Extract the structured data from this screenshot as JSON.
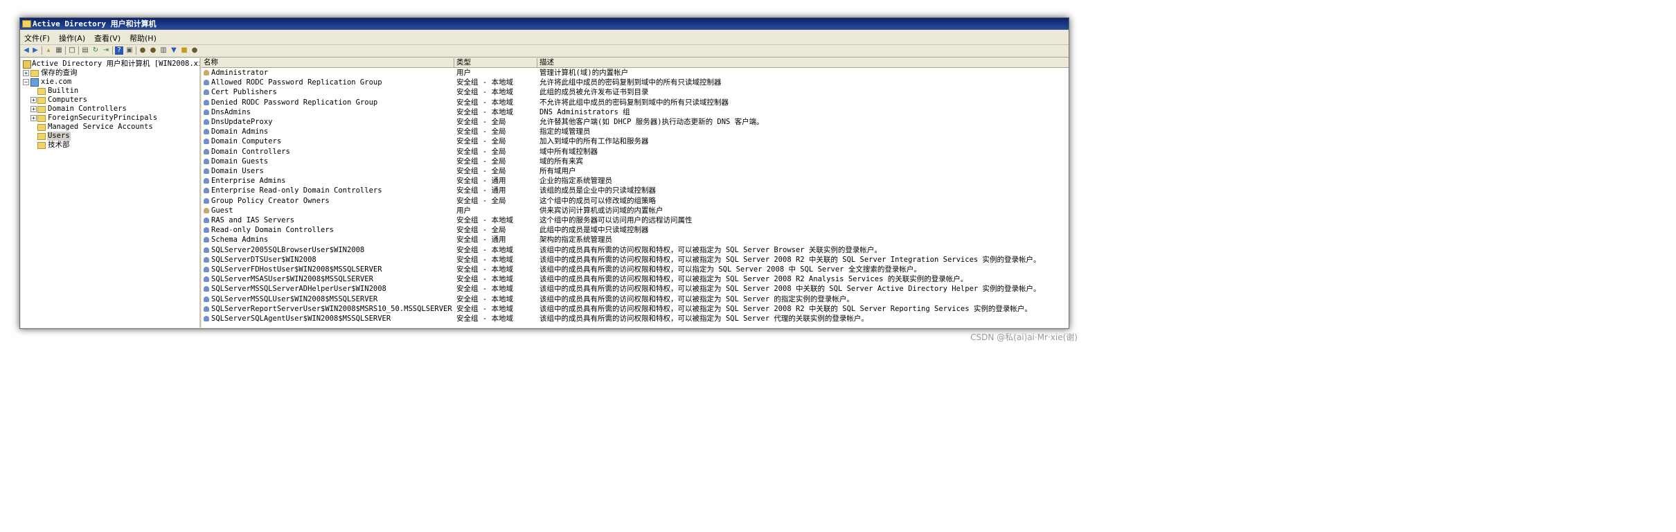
{
  "window": {
    "title": "Active Directory 用户和计算机"
  },
  "menu": [
    "文件(F)",
    "操作(A)",
    "查看(V)",
    "帮助(H)"
  ],
  "toolbar": {
    "icons": [
      "back-icon",
      "forward-icon",
      "up-icon",
      "show-tree-icon",
      "delete-icon",
      "properties-icon",
      "refresh-icon",
      "export-icon",
      "help-icon",
      "console-icon",
      "new-user-icon",
      "new-group-icon",
      "new-ou-icon",
      "filter-icon",
      "find-icon",
      "add-to-group-icon"
    ]
  },
  "tree": {
    "root": "Active Directory 用户和计算机 [WIN2008.xie",
    "saved_queries": "保存的查询",
    "domain": "xie.com",
    "children": [
      "Builtin",
      "Computers",
      "Domain Controllers",
      "ForeignSecurityPrincipals",
      "Managed Service Accounts",
      "Users",
      "技术部"
    ],
    "selected": "Users"
  },
  "columns": [
    "名称",
    "类型",
    "描述"
  ],
  "rows": [
    {
      "name": "Administrator",
      "type": "用户",
      "desc": "管理计算机(域)的内置帐户"
    },
    {
      "name": "Allowed RODC Password Replication Group",
      "type": "安全组 - 本地域",
      "desc": "允许将此组中成员的密码复制到域中的所有只读域控制器"
    },
    {
      "name": "Cert Publishers",
      "type": "安全组 - 本地域",
      "desc": "此组的成员被允许发布证书到目录"
    },
    {
      "name": "Denied RODC Password Replication Group",
      "type": "安全组 - 本地域",
      "desc": "不允许将此组中成员的密码复制到域中的所有只读域控制器"
    },
    {
      "name": "DnsAdmins",
      "type": "安全组 - 本地域",
      "desc": "DNS Administrators 组"
    },
    {
      "name": "DnsUpdateProxy",
      "type": "安全组 - 全局",
      "desc": "允许替其他客户端(如 DHCP 服务器)执行动态更新的 DNS 客户端。"
    },
    {
      "name": "Domain Admins",
      "type": "安全组 - 全局",
      "desc": "指定的域管理员"
    },
    {
      "name": "Domain Computers",
      "type": "安全组 - 全局",
      "desc": "加入到域中的所有工作站和服务器"
    },
    {
      "name": "Domain Controllers",
      "type": "安全组 - 全局",
      "desc": "域中所有域控制器"
    },
    {
      "name": "Domain Guests",
      "type": "安全组 - 全局",
      "desc": "域的所有来宾"
    },
    {
      "name": "Domain Users",
      "type": "安全组 - 全局",
      "desc": "所有域用户"
    },
    {
      "name": "Enterprise Admins",
      "type": "安全组 - 通用",
      "desc": "企业的指定系统管理员"
    },
    {
      "name": "Enterprise Read-only Domain Controllers",
      "type": "安全组 - 通用",
      "desc": "该组的成员是企业中的只读域控制器"
    },
    {
      "name": "Group Policy Creator Owners",
      "type": "安全组 - 全局",
      "desc": "这个组中的成员可以修改域的组策略"
    },
    {
      "name": "Guest",
      "type": "用户",
      "desc": "供来宾访问计算机或访问域的内置帐户"
    },
    {
      "name": "RAS and IAS Servers",
      "type": "安全组 - 本地域",
      "desc": "这个组中的服务器可以访问用户的远程访问属性"
    },
    {
      "name": "Read-only Domain Controllers",
      "type": "安全组 - 全局",
      "desc": "此组中的成员是域中只读域控制器"
    },
    {
      "name": "Schema Admins",
      "type": "安全组 - 通用",
      "desc": "架构的指定系统管理员"
    },
    {
      "name": "SQLServer2005SQLBrowserUser$WIN2008",
      "type": "安全组 - 本地域",
      "desc": "该组中的成员具有所需的访问权限和特权，可以被指定为 SQL Server Browser 关联实例的登录帐户。"
    },
    {
      "name": "SQLServerDTSUser$WIN2008",
      "type": "安全组 - 本地域",
      "desc": "该组中的成员具有所需的访问权限和特权，可以被指定为 SQL Server 2008 R2 中关联的 SQL Server Integration Services 实例的登录帐户。"
    },
    {
      "name": "SQLServerFDHostUser$WIN2008$MSSQLSERVER",
      "type": "安全组 - 本地域",
      "desc": "该组中的成员具有所需的访问权限和特权，可以指定为 SQL Server 2008 中 SQL Server 全文搜索的登录帐户。"
    },
    {
      "name": "SQLServerMSASUser$WIN2008$MSSQLSERVER",
      "type": "安全组 - 本地域",
      "desc": "该组中的成员具有所需的访问权限和特权，可以被指定为 SQL Server 2008 R2 Analysis Services 的关联实例的登录帐户。"
    },
    {
      "name": "SQLServerMSSQLServerADHelperUser$WIN2008",
      "type": "安全组 - 本地域",
      "desc": "该组中的成员具有所需的访问权限和特权，可以被指定为 SQL Server 2008 中关联的 SQL Server Active Directory Helper 实例的登录帐户。"
    },
    {
      "name": "SQLServerMSSQLUser$WIN2008$MSSQLSERVER",
      "type": "安全组 - 本地域",
      "desc": "该组中的成员具有所需的访问权限和特权，可以被指定为 SQL Server 的指定实例的登录帐户。"
    },
    {
      "name": "SQLServerReportServerUser$WIN2008$MSRS10_50.MSSQLSERVER",
      "type": "安全组 - 本地域",
      "desc": "该组中的成员具有所需的访问权限和特权，可以被指定为 SQL Server 2008 R2 中关联的 SQL Server Reporting Services 实例的登录帐户。"
    },
    {
      "name": "SQLServerSQLAgentUser$WIN2008$MSSQLSERVER",
      "type": "安全组 - 本地域",
      "desc": "该组中的成员具有所需的访问权限和特权，可以被指定为 SQL Server 代理的关联实例的登录帐户。"
    }
  ],
  "watermark": "CSDN @私(ai)ai·Mr·xie(谢)"
}
